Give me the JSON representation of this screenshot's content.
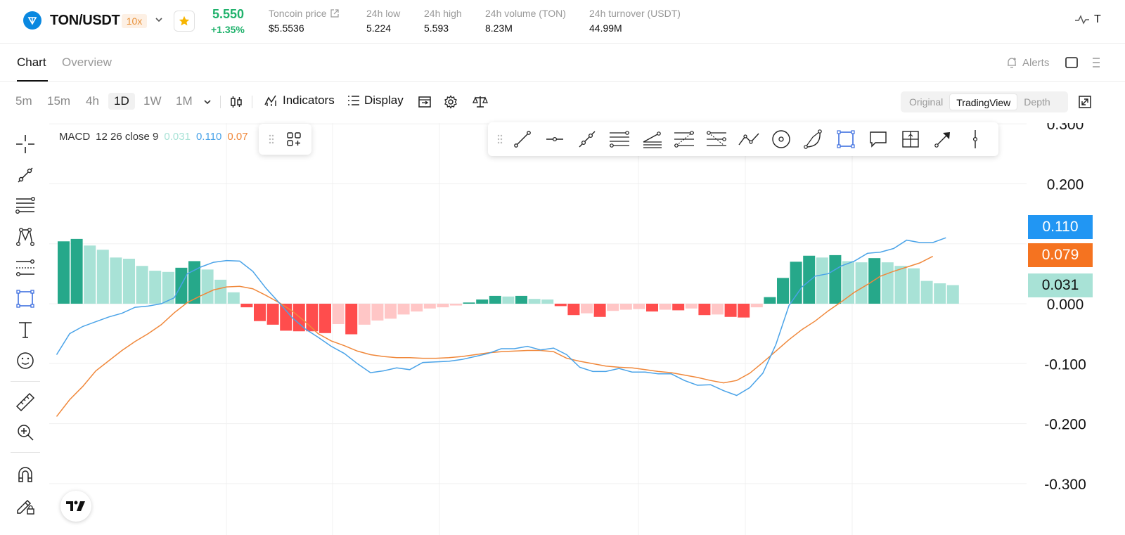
{
  "ticker": {
    "pair": "TON/USDT",
    "leverage": "10x",
    "last_price": "5.550",
    "change_pct": "+1.35%",
    "stats": [
      {
        "label": "Toncoin price",
        "value": "$5.5536"
      },
      {
        "label": "24h low",
        "value": "5.224"
      },
      {
        "label": "24h high",
        "value": "5.593"
      },
      {
        "label": "24h volume (TON)",
        "value": "8.23M"
      },
      {
        "label": "24h turnover (USDT)",
        "value": "44.99M"
      }
    ],
    "right_text": "T"
  },
  "tabs": {
    "items": [
      "Chart",
      "Overview"
    ],
    "active": "Chart",
    "alerts_label": "Alerts"
  },
  "toolbar": {
    "timeframes": [
      "5m",
      "15m",
      "4h",
      "1D",
      "1W",
      "1M"
    ],
    "active_timeframe": "1D",
    "indicators_label": "Indicators",
    "display_label": "Display",
    "views": [
      "Original",
      "TradingView",
      "Depth"
    ],
    "active_view": "TradingView"
  },
  "left_tools": [
    "crosshair-icon",
    "trend-line-icon",
    "fib-icon",
    "pattern-icon",
    "projection-icon",
    "rectangle-icon",
    "text-icon",
    "emoji-icon",
    "ruler-icon",
    "zoom-in-icon",
    "magnet-icon",
    "lock-drawing-icon"
  ],
  "drawing_panel_tools": [
    "drag-handle-icon",
    "line-icon",
    "horizontal-ray-icon",
    "trend-angle-icon",
    "parallel-channel-icon",
    "pitchfork-icon",
    "fib-retracement-icon",
    "fib-extension-icon",
    "polyline-icon",
    "circle-icon",
    "arc-icon",
    "rectangle-icon",
    "callout-icon",
    "grid-icon",
    "arrow-icon",
    "vertical-line-icon"
  ],
  "chart_data": {
    "type": "bar",
    "indicator": "MACD",
    "legend": {
      "name": "MACD",
      "params": "12 26 close 9",
      "histogram": "0.031",
      "macd": "0.110",
      "signal": "0.07"
    },
    "ylim": [
      -0.34,
      0.3
    ],
    "yticks": [
      "0.300",
      "0.200",
      "0.110",
      "0.079",
      "0.031",
      "0.000",
      "-0.100",
      "-0.200",
      "-0.300"
    ],
    "grid": true,
    "histogram": [
      0.104,
      0.108,
      0.097,
      0.09,
      0.077,
      0.075,
      0.063,
      0.055,
      0.053,
      0.06,
      0.071,
      0.057,
      0.04,
      0.019,
      -0.006,
      -0.029,
      -0.035,
      -0.045,
      -0.046,
      -0.046,
      -0.049,
      -0.034,
      -0.051,
      -0.035,
      -0.028,
      -0.025,
      -0.018,
      -0.013,
      -0.008,
      -0.006,
      -0.003,
      0.002,
      0.007,
      0.013,
      0.012,
      0.013,
      0.008,
      0.007,
      -0.004,
      -0.019,
      -0.016,
      -0.022,
      -0.012,
      -0.01,
      -0.009,
      -0.013,
      -0.01,
      -0.011,
      -0.008,
      -0.019,
      -0.018,
      -0.022,
      -0.023,
      -0.006,
      0.011,
      0.043,
      0.07,
      0.08,
      0.077,
      0.081,
      0.071,
      0.069,
      0.076,
      0.069,
      0.063,
      0.059,
      0.038,
      0.034,
      0.031
    ],
    "macd_line": [
      -0.085,
      -0.05,
      -0.038,
      -0.03,
      -0.022,
      -0.016,
      -0.006,
      -0.004,
      0,
      0.01,
      0.05,
      0.061,
      0.069,
      0.072,
      0.071,
      0.054,
      0.026,
      0.002,
      -0.023,
      -0.042,
      -0.056,
      -0.071,
      -0.083,
      -0.1,
      -0.115,
      -0.112,
      -0.107,
      -0.11,
      -0.098,
      -0.097,
      -0.096,
      -0.093,
      -0.088,
      -0.083,
      -0.075,
      -0.075,
      -0.071,
      -0.077,
      -0.074,
      -0.085,
      -0.106,
      -0.113,
      -0.113,
      -0.108,
      -0.114,
      -0.114,
      -0.117,
      -0.117,
      -0.128,
      -0.136,
      -0.135,
      -0.145,
      -0.153,
      -0.14,
      -0.116,
      -0.068,
      -0.003,
      0.028,
      0.046,
      0.05,
      0.063,
      0.071,
      0.084,
      0.086,
      0.092,
      0.106,
      0.102,
      0.102,
      0.11
    ],
    "signal_line": [
      -0.188,
      -0.16,
      -0.138,
      -0.112,
      -0.095,
      -0.078,
      -0.063,
      -0.05,
      -0.035,
      -0.015,
      0.002,
      0.013,
      0.023,
      0.028,
      0.029,
      0.025,
      0.014,
      0.002,
      -0.012,
      -0.03,
      -0.05,
      -0.062,
      -0.07,
      -0.079,
      -0.085,
      -0.088,
      -0.09,
      -0.09,
      -0.091,
      -0.091,
      -0.09,
      -0.088,
      -0.085,
      -0.082,
      -0.08,
      -0.079,
      -0.078,
      -0.078,
      -0.08,
      -0.091,
      -0.096,
      -0.1,
      -0.104,
      -0.106,
      -0.107,
      -0.11,
      -0.113,
      -0.115,
      -0.119,
      -0.123,
      -0.128,
      -0.132,
      -0.128,
      -0.116,
      -0.098,
      -0.079,
      -0.06,
      -0.043,
      -0.029,
      -0.012,
      0.003,
      0.019,
      0.032,
      0.046,
      0.054,
      0.061,
      0.068,
      0.079
    ],
    "colors": {
      "hist_up_strong": "#26a88a",
      "hist_up_weak": "#a8e2d6",
      "hist_down_strong": "#ff4d4d",
      "hist_down_weak": "#ffc6c6",
      "macd": "#4aa3e8",
      "signal": "#f0883b",
      "macd_tag": "#2196f3",
      "signal_tag": "#f57320",
      "hist_tag": "#a8e2d6"
    }
  }
}
